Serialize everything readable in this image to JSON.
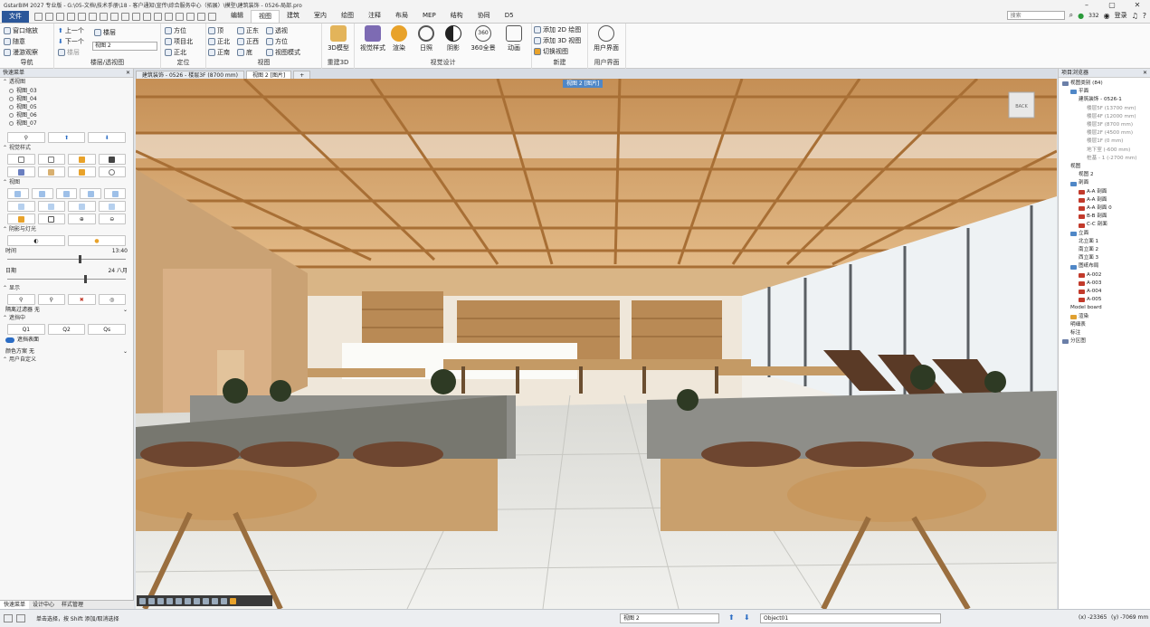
{
  "window": {
    "title": "GstarBIM 2027 专业版 - G:\\05-文档\\技术手册\\18 - 客户通知\\宣传\\综合服务中心（拓展）\\模型\\建筑装饰 - 0526-局部.pro"
  },
  "menubar": {
    "file": "文件",
    "tabs": [
      "编辑",
      "视图",
      "建筑",
      "室内",
      "绘图",
      "注释",
      "布局",
      "MEP",
      "结构",
      "协同",
      "D5"
    ],
    "active_tab": "视图",
    "search_placeholder": "搜索",
    "user_count": "332",
    "login": "登录"
  },
  "ribbon": {
    "nav": {
      "items": [
        "窗口缩放",
        "随意",
        "漫游观察"
      ],
      "label": "导航"
    },
    "floor": {
      "up": "上一个",
      "down": "下一个",
      "floor_btn": "楼层",
      "prev_floor": "楼层",
      "view_select": "视图 2",
      "label": "楼层/透视图"
    },
    "locate": {
      "items": [
        "方位",
        "项目北",
        "正北"
      ],
      "label": "定位"
    },
    "views": {
      "items": [
        "顶",
        "正北",
        "正南",
        "正东",
        "正西",
        "底",
        "透视",
        "方位",
        "视图模式"
      ],
      "label": "视图"
    },
    "render3d": {
      "btn": "3D模型",
      "label": "重建3D"
    },
    "visual": {
      "btns": [
        "视觉样式",
        "渲染",
        "日照",
        "阴影",
        "360全景",
        "动画"
      ],
      "label": "视觉设计"
    },
    "newview": {
      "items": [
        "添加 2D 绘图",
        "添加 3D 视图",
        "切换视图"
      ],
      "label": "新建"
    },
    "user": {
      "btn": "用户界面",
      "label": "用户界面"
    }
  },
  "left_panel": {
    "title": "快速菜单",
    "persp_section": "透视图",
    "views": [
      "视图_03",
      "视图_04",
      "视图_05",
      "视图_06",
      "视图_07"
    ],
    "style_section": "视觉样式",
    "view_section": "视图",
    "shadow_section": "阴影与灯光",
    "time_label": "时间",
    "time_value": "13:40",
    "date_label": "日期",
    "date_value": "24 八月",
    "show_section": "显示",
    "filter_label": "隔离过滤器",
    "filter_value": "无",
    "highlight_section": "遮挡中",
    "q_items": [
      "Q1",
      "Q2",
      "Qs"
    ],
    "toggle_label": "遮挡表面",
    "color_label": "颜色方案",
    "color_value": "无",
    "user_def": "用户自定义",
    "bottom_tabs": [
      "快速菜单",
      "设计中心",
      "样式管理"
    ],
    "time_pos": 0.6,
    "date_pos": 0.65
  },
  "doc_tabs": [
    "建筑装饰 - 0526 - 楼层3F (8700 mm)",
    "视图 2 [图片]",
    "+"
  ],
  "viewport": {
    "label": "视图 2 [图片]",
    "cube": "BACK"
  },
  "project_tree": {
    "title": "项目浏览器",
    "items": [
      {
        "t": "视图类别 (84)",
        "lvl": 0,
        "c": "#6b7fa8"
      },
      {
        "t": "平面",
        "lvl": 1,
        "c": "#4f87c7"
      },
      {
        "t": "建筑装饰 - 0526-1",
        "lvl": 2,
        "c": ""
      },
      {
        "t": "楼层5F (13700 mm)",
        "lvl": 3,
        "c": ""
      },
      {
        "t": "楼层4F (12000 mm)",
        "lvl": 3,
        "c": ""
      },
      {
        "t": "楼层3F (8700 mm)",
        "lvl": 3,
        "c": ""
      },
      {
        "t": "楼层2F (4500 mm)",
        "lvl": 3,
        "c": ""
      },
      {
        "t": "楼层1F (0 mm)",
        "lvl": 3,
        "c": ""
      },
      {
        "t": "地下室 (-600 mm)",
        "lvl": 3,
        "c": ""
      },
      {
        "t": "桩基 - 1 (-2700 mm)",
        "lvl": 3,
        "c": ""
      },
      {
        "t": "视图",
        "lvl": 1,
        "c": ""
      },
      {
        "t": "视图 2",
        "lvl": 2,
        "c": ""
      },
      {
        "t": "剖面",
        "lvl": 1,
        "c": "#4f87c7"
      },
      {
        "t": "A-A 剖面",
        "lvl": 2,
        "c": "#c23a2b"
      },
      {
        "t": "A-A 剖面",
        "lvl": 2,
        "c": "#c23a2b"
      },
      {
        "t": "A-A 剖面 0",
        "lvl": 2,
        "c": "#c23a2b"
      },
      {
        "t": "B-B 剖面",
        "lvl": 2,
        "c": "#c23a2b"
      },
      {
        "t": "C-C 剖面",
        "lvl": 2,
        "c": "#c23a2b"
      },
      {
        "t": "立面",
        "lvl": 1,
        "c": "#4f87c7"
      },
      {
        "t": "北立面 1",
        "lvl": 2,
        "c": ""
      },
      {
        "t": "南立面 2",
        "lvl": 2,
        "c": ""
      },
      {
        "t": "西立面 3",
        "lvl": 2,
        "c": ""
      },
      {
        "t": "图纸布局",
        "lvl": 1,
        "c": "#4f87c7"
      },
      {
        "t": "A-002",
        "lvl": 2,
        "c": "#c23a2b"
      },
      {
        "t": "A-003",
        "lvl": 2,
        "c": "#c23a2b"
      },
      {
        "t": "A-004",
        "lvl": 2,
        "c": "#c23a2b"
      },
      {
        "t": "A-005",
        "lvl": 2,
        "c": "#c23a2b"
      },
      {
        "t": "Model board",
        "lvl": 1,
        "c": ""
      },
      {
        "t": "渲染",
        "lvl": 1,
        "c": "#e0a030"
      },
      {
        "t": "明细表",
        "lvl": 1,
        "c": ""
      },
      {
        "t": "标注",
        "lvl": 1,
        "c": ""
      },
      {
        "t": "分区图",
        "lvl": 0,
        "c": "#6b7fa8"
      }
    ]
  },
  "statusbar": {
    "hint": "单击选择，按 Shift 添加/取消选择",
    "view": "视图 2",
    "object": "Object01",
    "x": "(x) -23365",
    "y": "(y) -7069 mm"
  }
}
